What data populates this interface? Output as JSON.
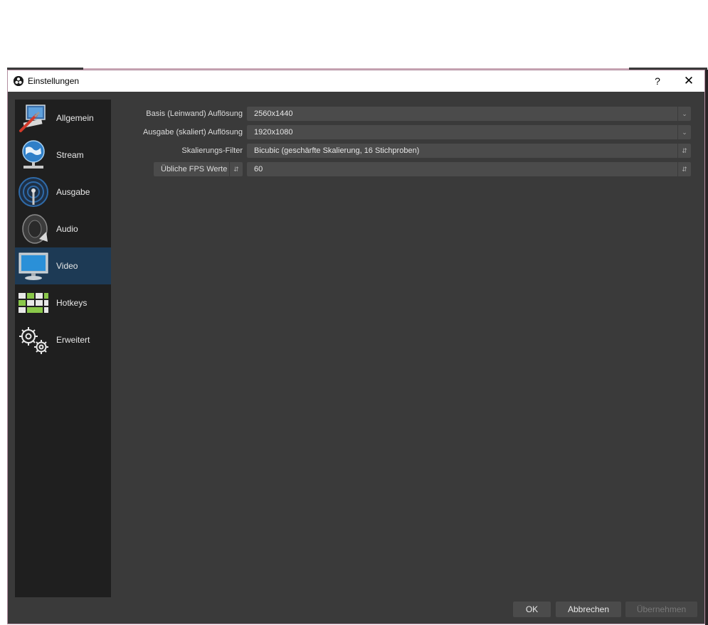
{
  "window": {
    "title": "Einstellungen",
    "help_label": "?",
    "close_label": "✕"
  },
  "sidebar": {
    "items": [
      {
        "label": "Allgemein",
        "icon": "general-icon"
      },
      {
        "label": "Stream",
        "icon": "globe-stream-icon"
      },
      {
        "label": "Ausgabe",
        "icon": "broadcast-antenna-icon"
      },
      {
        "label": "Audio",
        "icon": "speaker-icon"
      },
      {
        "label": "Video",
        "icon": "monitor-icon",
        "active": true
      },
      {
        "label": "Hotkeys",
        "icon": "keyboard-icon"
      },
      {
        "label": "Erweitert",
        "icon": "gears-icon"
      }
    ]
  },
  "video": {
    "base_resolution_label": "Basis (Leinwand) Auflösung",
    "base_resolution_value": "2560x1440",
    "output_resolution_label": "Ausgabe (skaliert) Auflösung",
    "output_resolution_value": "1920x1080",
    "scale_filter_label": "Skalierungs-Filter",
    "scale_filter_value": "Bicubic (geschärfte Skalierung, 16 Stichproben)",
    "fps_type_value": "Übliche FPS Werte",
    "fps_value": "60"
  },
  "buttons": {
    "ok": "OK",
    "cancel": "Abbrechen",
    "apply": "Übernehmen"
  },
  "colors": {
    "active_item": "#1d3a55",
    "sidebar": "#1f1f1f",
    "panel": "#3a3a3a",
    "field": "#4b4b4b"
  }
}
